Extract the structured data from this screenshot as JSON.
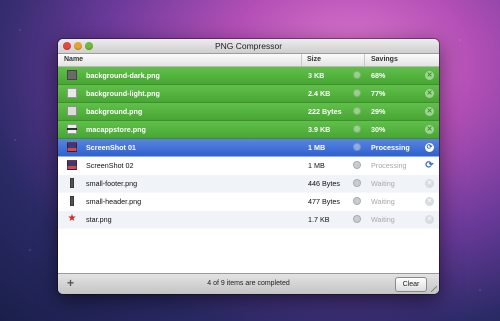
{
  "window": {
    "title": "PNG Compressor"
  },
  "columns": {
    "size": "Size",
    "savings": "Savings"
  },
  "files": [
    {
      "name": "background-dark.png",
      "size": "3 KB",
      "savings": "68%",
      "state": "done",
      "thumb": "dark"
    },
    {
      "name": "background-light.png",
      "size": "2.4 KB",
      "savings": "77%",
      "state": "done",
      "thumb": "light"
    },
    {
      "name": "background.png",
      "size": "222 Bytes",
      "savings": "29%",
      "state": "done",
      "thumb": "bg"
    },
    {
      "name": "macappstore.png",
      "size": "3.9 KB",
      "savings": "30%",
      "state": "done",
      "thumb": "bar"
    },
    {
      "name": "ScreenShot 01",
      "size": "1 MB",
      "savings": "Processing",
      "state": "active",
      "thumb": "shot"
    },
    {
      "name": "ScreenShot 02",
      "size": "1 MB",
      "savings": "Processing",
      "state": "queued",
      "thumb": "shot"
    },
    {
      "name": "small-footer.png",
      "size": "446 Bytes",
      "savings": "Waiting",
      "state": "waiting",
      "thumb": "tall"
    },
    {
      "name": "small-header.png",
      "size": "477 Bytes",
      "savings": "Waiting",
      "state": "waiting",
      "thumb": "tall"
    },
    {
      "name": "star.png",
      "size": "1.7 KB",
      "savings": "Waiting",
      "state": "waiting",
      "thumb": "star"
    }
  ],
  "footer": {
    "add_label": "+",
    "status": "4 of 9 items are completed",
    "clear_label": "Clear"
  }
}
